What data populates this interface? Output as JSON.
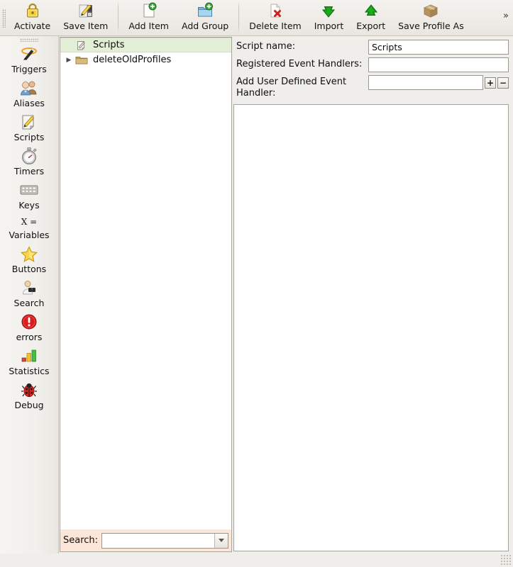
{
  "toolbar": {
    "grip_name": "toolbar-drag-handle",
    "overflow_label": "»",
    "items": [
      {
        "label": "Activate",
        "icon": "lock-icon"
      },
      {
        "label": "Save Item",
        "icon": "save-item-icon"
      },
      {
        "label": "Add Item",
        "icon": "add-item-icon"
      },
      {
        "label": "Add Group",
        "icon": "add-group-icon"
      },
      {
        "label": "Delete Item",
        "icon": "delete-item-icon"
      },
      {
        "label": "Import",
        "icon": "import-down-arrow-icon"
      },
      {
        "label": "Export",
        "icon": "export-up-arrow-icon"
      },
      {
        "label": "Save Profile As",
        "icon": "package-box-icon"
      }
    ]
  },
  "sidebar": {
    "items": [
      {
        "label": "Triggers",
        "icon": "magic-wand-icon"
      },
      {
        "label": "Aliases",
        "icon": "people-icon"
      },
      {
        "label": "Scripts",
        "icon": "notepad-pencil-icon"
      },
      {
        "label": "Timers",
        "icon": "stopwatch-icon"
      },
      {
        "label": "Keys",
        "icon": "keyboard-icon"
      },
      {
        "label": "Variables",
        "icon": "x-equals-icon",
        "icon_text": "X ="
      },
      {
        "label": "Buttons",
        "icon": "star-icon"
      },
      {
        "label": "Search",
        "icon": "person-binoculars-icon"
      },
      {
        "label": "errors",
        "icon": "error-exclamation-icon"
      },
      {
        "label": "Statistics",
        "icon": "bar-chart-icon"
      },
      {
        "label": "Debug",
        "icon": "ladybug-icon"
      }
    ]
  },
  "tree": {
    "rows": [
      {
        "label": "Scripts",
        "icon": "script-page-icon",
        "selected": true,
        "expandable": false,
        "expanded": false,
        "indent": 0
      },
      {
        "label": "deleteOldProfiles",
        "icon": "folder-icon",
        "selected": false,
        "expandable": true,
        "expanded": false,
        "indent": 0
      }
    ],
    "collapse_arrow": "▶"
  },
  "search": {
    "label": "Search:",
    "value": "",
    "placeholder": "",
    "dropdown_name": "search-dropdown-arrow",
    "close_name": "close-search-button"
  },
  "form": {
    "script_name": {
      "label": "Script name:",
      "value": "Scripts",
      "placeholder": ""
    },
    "registered_handlers": {
      "label": "Registered Event Handlers:",
      "value": "",
      "placeholder": ""
    },
    "add_handler": {
      "label": "Add User Defined Event Handler:",
      "value": "",
      "placeholder": "",
      "add_button": "+",
      "remove_button": "−"
    }
  },
  "editor": {
    "name": "script-code-editor",
    "value": ""
  },
  "colors": {
    "toolbar_bg": "#efece7",
    "sidebar_bg": "#f2f0ec",
    "panel_bg": "#ffffff",
    "selection_green": "#e3eed7",
    "search_bar_peach": "#fbe6d8",
    "border": "#a8a49c",
    "text": "#1b1b1b"
  }
}
